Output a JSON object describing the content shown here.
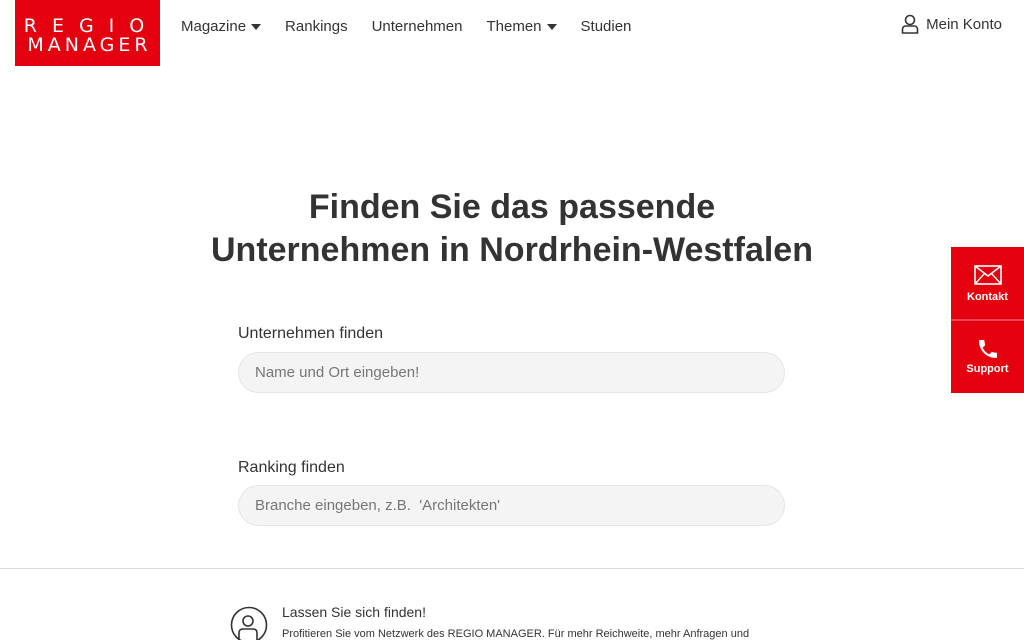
{
  "header": {
    "logo": {
      "line1": "REGIO",
      "line2": "MANAGER"
    },
    "nav": [
      {
        "label": "Magazine",
        "dropdown": true
      },
      {
        "label": "Rankings",
        "dropdown": false
      },
      {
        "label": "Unternehmen",
        "dropdown": false
      },
      {
        "label": "Themen",
        "dropdown": true
      },
      {
        "label": "Studien",
        "dropdown": false
      }
    ],
    "account": {
      "label": "Mein Konto",
      "icon": "user-icon"
    }
  },
  "hero": {
    "title_line1": "Finden Sie das passende",
    "title_line2": "Unternehmen in Nordrhein-Westfalen"
  },
  "search": {
    "company": {
      "label": "Unternehmen finden",
      "placeholder": "Name und Ort eingeben!",
      "value": ""
    },
    "ranking": {
      "label": "Ranking finden",
      "placeholder": "Branche eingeben, z.B.  'Architekten'",
      "value": ""
    }
  },
  "promo": {
    "icon": "person-search-icon",
    "title": "Lassen Sie sich finden!",
    "text": "Profitieren Sie vom Netzwerk des REGIO MANAGER. Für mehr Reichweite, mehr Anfragen und"
  },
  "side_widget": {
    "contact": {
      "label": "Kontakt",
      "icon": "envelope-icon"
    },
    "support": {
      "label": "Support",
      "icon": "phone-icon"
    }
  },
  "colors": {
    "brand_red": "#e3000f",
    "text": "#333333",
    "input_bg": "#f4f4f4"
  }
}
